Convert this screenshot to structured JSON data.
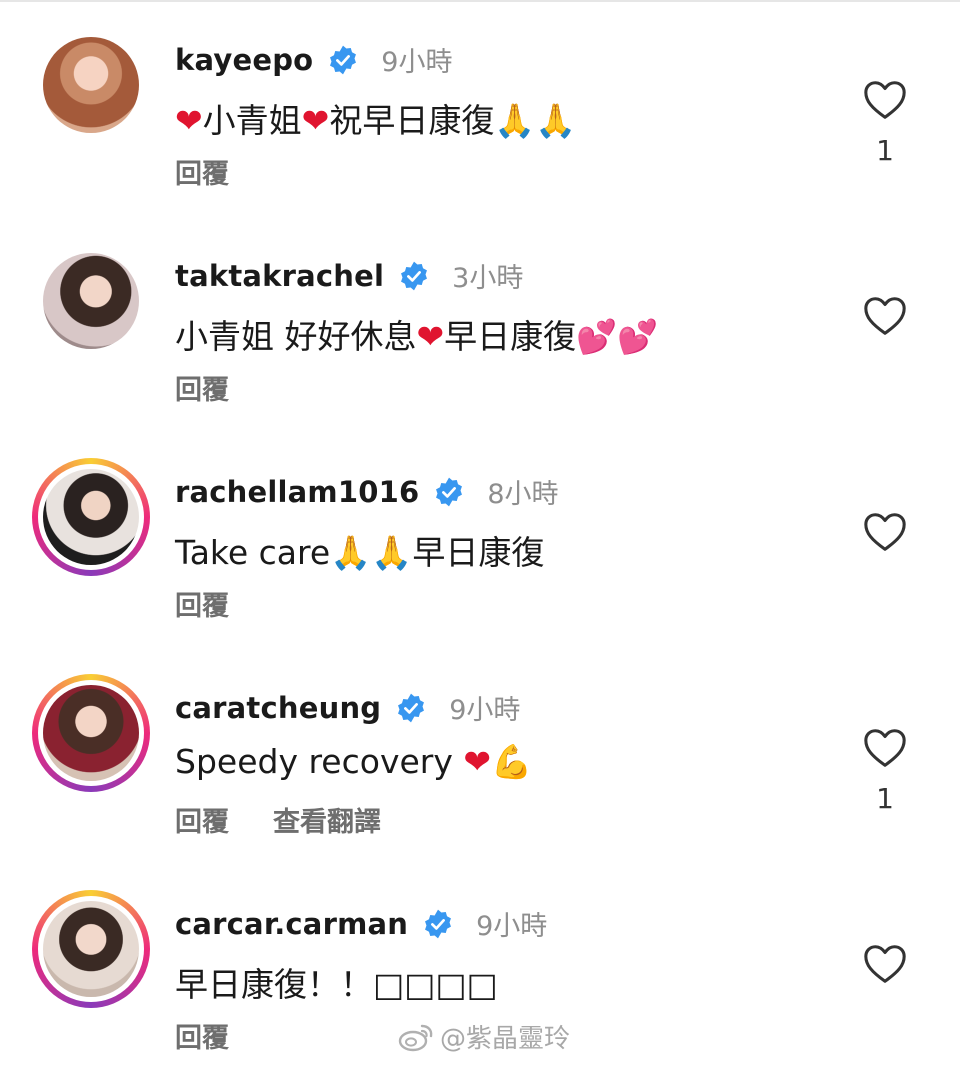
{
  "comments": [
    {
      "username": "kayeepo",
      "time": "9小時",
      "text_parts": [
        "❤",
        "小青姐",
        "❤",
        "祝早日康復",
        "🙏🙏"
      ],
      "reply_label": "回覆",
      "like_count": "1",
      "verified": true
    },
    {
      "username": "taktakrachel",
      "time": "3小時",
      "text_parts": [
        "小青姐 好好休息",
        "❤",
        "早日康復",
        "💕💕"
      ],
      "reply_label": "回覆",
      "like_count": "",
      "verified": true
    },
    {
      "username": "rachellam1016",
      "time": "8小時",
      "text_parts": [
        "Take care",
        "🙏🙏",
        "早日康復"
      ],
      "reply_label": "回覆",
      "like_count": "",
      "verified": true
    },
    {
      "username": "caratcheung",
      "time": "9小時",
      "text_parts": [
        "Speedy recovery ",
        "❤",
        "💪"
      ],
      "reply_label": "回覆",
      "translate_label": "查看翻譯",
      "like_count": "1",
      "verified": true
    },
    {
      "username": "carcar.carman",
      "time": "9小時",
      "text_parts": [
        "早日康復！！",
        "□□□□"
      ],
      "reply_label": "回覆",
      "like_count": "",
      "verified": true
    }
  ],
  "watermark": {
    "text": "@紫晶靈玲",
    "icon": "weibo-icon"
  },
  "colors": {
    "verified_blue": "#3897f0",
    "time_gray": "#8e8e8e",
    "heart_red": "#e0142f"
  }
}
